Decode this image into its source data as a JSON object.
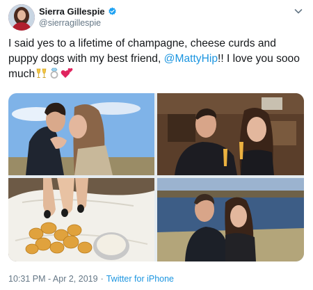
{
  "tweet": {
    "display_name": "Sierra Gillespie",
    "handle": "@sierragillespie",
    "text_before": "I said yes to a lifetime of champagne, cheese curds and puppy dogs with my best friend, ",
    "mention": "@MattyHip",
    "text_after": "!! I love you sooo much",
    "emojis": [
      "champagne-glasses-icon",
      "ring-icon",
      "two-hearts-icon"
    ],
    "timestamp": "10:31 PM - Apr 2, 2019",
    "separator": "·",
    "source": "Twitter for iPhone"
  },
  "colors": {
    "link": "#1b95e0",
    "verified": "#1da1f2",
    "secondary_text": "#657786"
  },
  "photos": [
    {
      "name": "photo-kiss-outdoors"
    },
    {
      "name": "photo-couple-restaurant"
    },
    {
      "name": "photo-cheese-curds"
    },
    {
      "name": "photo-couple-lake"
    }
  ]
}
